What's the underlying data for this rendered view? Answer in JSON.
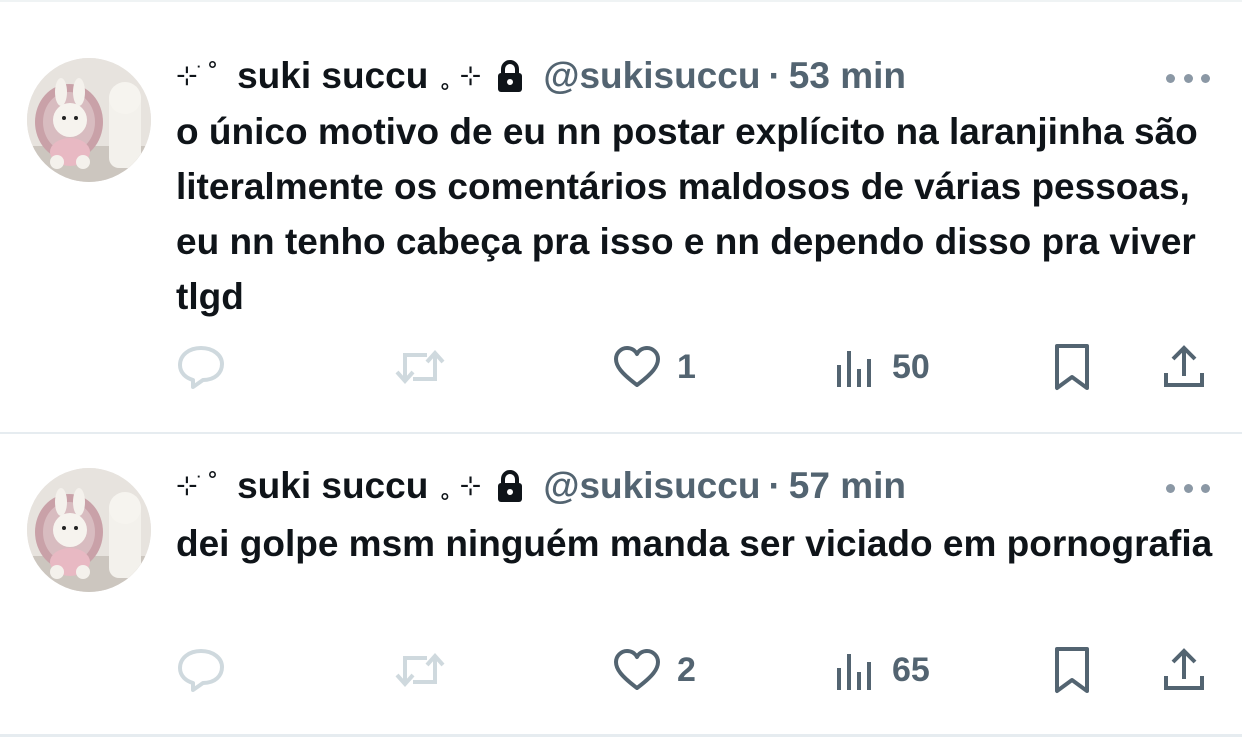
{
  "tweets": [
    {
      "display_name": "suki succu",
      "deco_left": "⊹ ֹ˚",
      "deco_right": "˳ ⊹",
      "handle": "@sukisuccu",
      "separator": "·",
      "time": "53 min",
      "text": "o único motivo de eu nn postar explícito na laranjinha são literalmente os comentários maldosos de várias pessoas, eu nn tenho cabeça pra isso e nn dependo disso pra viver tlgd",
      "likes": "1",
      "views": "50",
      "locked": true
    },
    {
      "display_name": "suki succu",
      "deco_left": "⊹ ֹ˚",
      "deco_right": "˳ ⊹",
      "handle": "@sukisuccu",
      "separator": "·",
      "time": "57 min",
      "text": "dei golpe msm ninguém manda ser viciado em pornografia",
      "likes": "2",
      "views": "65",
      "locked": true
    }
  ],
  "colors": {
    "text": "#0f1419",
    "secondary": "#536471",
    "disabled_icon": "#cfd9de",
    "divider": "#e6ecf0"
  },
  "icons": [
    "lock-icon",
    "reply-icon",
    "retweet-icon",
    "heart-icon",
    "views-icon",
    "bookmark-icon",
    "share-icon",
    "more-icon"
  ]
}
